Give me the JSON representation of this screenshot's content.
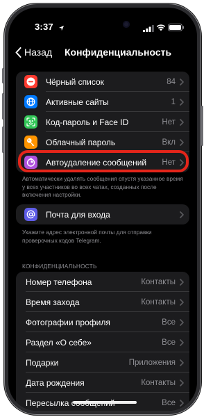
{
  "status": {
    "time": "3:37"
  },
  "nav": {
    "back_label": "Назад",
    "title": "Конфиденциальность"
  },
  "group1": [
    {
      "label": "Чёрный список",
      "value": "84",
      "color": "#ff3b30",
      "icon": "minus-circle-icon"
    },
    {
      "label": "Активные сайты",
      "value": "1",
      "color": "#007aff",
      "icon": "globe-icon"
    },
    {
      "label": "Код-пароль и Face ID",
      "value": "Нет",
      "color": "#34c759",
      "icon": "face-id-icon"
    },
    {
      "label": "Облачный пароль",
      "value": "Вкл",
      "color": "#ff9500",
      "icon": "key-icon"
    },
    {
      "label": "Автоудаление сообщений",
      "value": "Нет",
      "color": "#af52de",
      "icon": "timer-icon"
    }
  ],
  "group1_footer": "Автоматически удалять сообщения спустя указанное время у всех участников во всех чатах, созданных после включения настройки.",
  "group2": {
    "label": "Почта для входа",
    "color": "#5e5ce6",
    "icon": "at-icon"
  },
  "group2_footer": "Укажите адрес электронной почты для отправки проверочных кодов Telegram.",
  "section_header": "КОНФИДЕНЦИАЛЬНОСТЬ",
  "group3": [
    {
      "label": "Номер телефона",
      "value": "Контакты"
    },
    {
      "label": "Время захода",
      "value": "Контакты"
    },
    {
      "label": "Фотографии профиля",
      "value": "Все"
    },
    {
      "label": "Раздел «О себе»",
      "value": "Все"
    },
    {
      "label": "Подарки",
      "value": "Приложения"
    },
    {
      "label": "Дата рождения",
      "value": "Контакты"
    },
    {
      "label": "Пересылка сообщений",
      "value": "Все"
    }
  ],
  "colors": {
    "highlight": "#e4251a",
    "background": "#000000",
    "cell": "#1c1c1e"
  }
}
